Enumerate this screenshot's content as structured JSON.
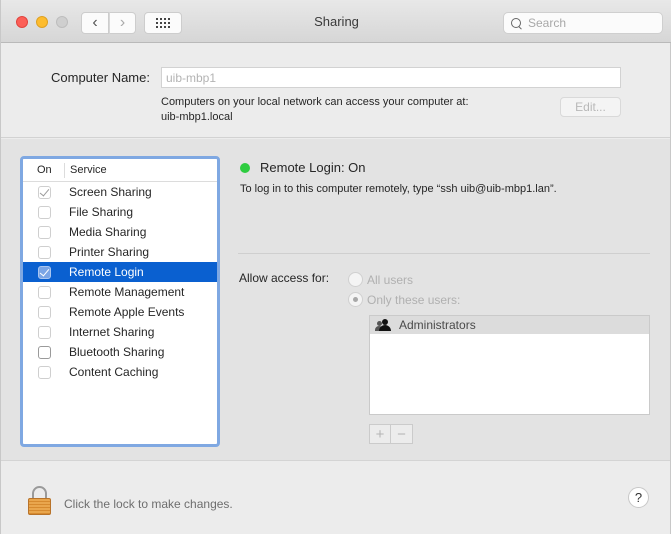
{
  "window": {
    "title": "Sharing",
    "search_placeholder": "Search",
    "nav_back_glyph": "‹",
    "nav_forward_glyph": "›"
  },
  "computer_name": {
    "label": "Computer Name:",
    "value": "uib-mbp1",
    "description_line1": "Computers on your local network can access your computer at:",
    "description_line2": "uib-mbp1.local",
    "edit_button": "Edit..."
  },
  "services": {
    "header_on": "On",
    "header_service": "Service",
    "selected_index": 4,
    "items": [
      {
        "name": "Screen Sharing",
        "enabled": true
      },
      {
        "name": "File Sharing",
        "enabled": false
      },
      {
        "name": "Media Sharing",
        "enabled": false
      },
      {
        "name": "Printer Sharing",
        "enabled": false
      },
      {
        "name": "Remote Login",
        "enabled": true
      },
      {
        "name": "Remote Management",
        "enabled": false
      },
      {
        "name": "Remote Apple Events",
        "enabled": false
      },
      {
        "name": "Internet Sharing",
        "enabled": false
      },
      {
        "name": "Bluetooth Sharing",
        "enabled": false
      },
      {
        "name": "Content Caching",
        "enabled": false
      }
    ]
  },
  "detail": {
    "status_title": "Remote Login: On",
    "status_color": "#2ecc40",
    "status_description": "To log in to this computer remotely, type “ssh uib@uib-mbp1.lan”.",
    "allow_access_label": "Allow access for:",
    "radio_all_users": "All users",
    "radio_only_these": "Only these users:",
    "selected_option": "Only these users",
    "users": [
      {
        "name": "Administrators",
        "icon": "group-icon"
      }
    ],
    "add_button": "+",
    "remove_button": "−"
  },
  "footer": {
    "lock_text": "Click the lock to make changes.",
    "help_button": "?"
  },
  "colors": {
    "selection": "#0a60d0",
    "focus_ring": "#7fa8e2"
  }
}
